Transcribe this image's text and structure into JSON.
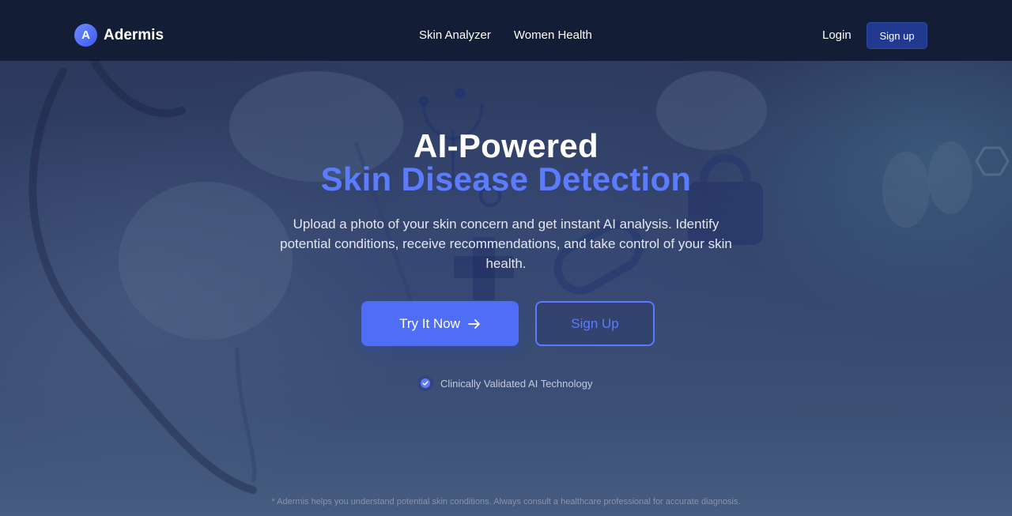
{
  "nav": {
    "logo_letter": "A",
    "brand_name": "Adermis",
    "links": [
      {
        "label": "Skin Analyzer"
      },
      {
        "label": "Women Health"
      }
    ],
    "login_label": "Login",
    "signup_label": "Sign up"
  },
  "hero": {
    "title_line1": "AI-Powered",
    "title_line2": "Skin Disease Detection",
    "description": "Upload a photo of your skin concern and get instant AI analysis. Identify potential conditions, receive recommendations, and take control of your skin health.",
    "primary_button": "Try It Now",
    "secondary_button": "Sign Up",
    "badge_text": "Clinically Validated AI Technology"
  },
  "disclaimer": "* Adermis helps you understand potential skin conditions. Always consult a healthcare professional for accurate diagnosis.",
  "colors": {
    "accent": "#4f6ef8",
    "nav_bg": "#141d36",
    "highlight_text": "#5b7cff"
  },
  "icons": {
    "arrow": "arrow-right-icon",
    "check": "check-circle-icon"
  }
}
